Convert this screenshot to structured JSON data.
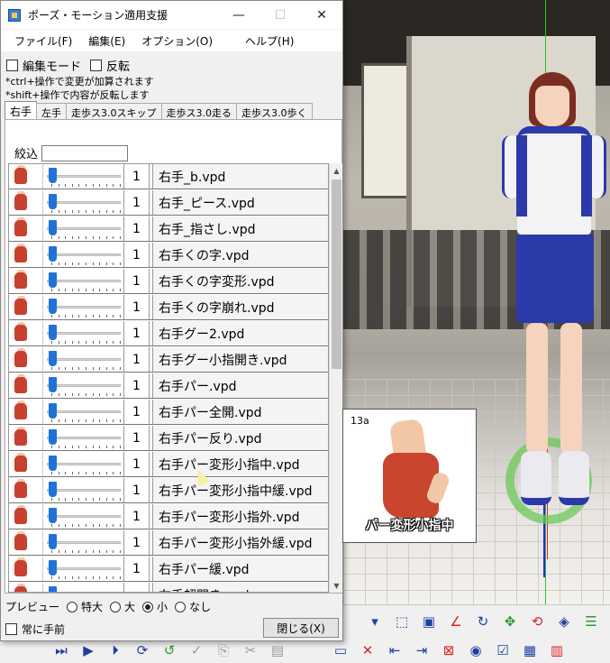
{
  "window": {
    "title": "ポーズ・モーション適用支援",
    "minimize": "—",
    "maximize": "☐",
    "close": "✕"
  },
  "menu": {
    "file": "ファイル(F)",
    "edit": "編集(E)",
    "options": "オプション(O)",
    "help": "ヘルプ(H)"
  },
  "options": {
    "edit_mode": "編集モード",
    "invert": "反転",
    "note1": "*ctrl+操作で変更が加算されます",
    "note2": "*shift+操作で内容が反転します"
  },
  "tabs": [
    {
      "label": "右手",
      "active": true
    },
    {
      "label": "左手",
      "active": false
    },
    {
      "label": "走歩ス3.0スキップ",
      "active": false
    },
    {
      "label": "走歩ス3.0走る",
      "active": false
    },
    {
      "label": "走歩ス3.0歩く",
      "active": false
    }
  ],
  "filter": {
    "label": "絞込",
    "value": ""
  },
  "items": [
    {
      "value": "1",
      "name": "右手_b.vpd"
    },
    {
      "value": "1",
      "name": "右手_ピース.vpd"
    },
    {
      "value": "1",
      "name": "右手_指さし.vpd"
    },
    {
      "value": "1",
      "name": "右手くの字.vpd"
    },
    {
      "value": "1",
      "name": "右手くの字変形.vpd"
    },
    {
      "value": "1",
      "name": "右手くの字崩れ.vpd"
    },
    {
      "value": "1",
      "name": "右手グー2.vpd"
    },
    {
      "value": "1",
      "name": "右手グー小指開き.vpd"
    },
    {
      "value": "1",
      "name": "右手パー.vpd"
    },
    {
      "value": "1",
      "name": "右手パー全開.vpd"
    },
    {
      "value": "1",
      "name": "右手パー反り.vpd"
    },
    {
      "value": "1",
      "name": "右手パー変形小指中.vpd"
    },
    {
      "value": "1",
      "name": "右手パー変形小指中緩.vpd"
    },
    {
      "value": "1",
      "name": "右手パー変形小指外.vpd"
    },
    {
      "value": "1",
      "name": "右手パー変形小指外緩.vpd"
    },
    {
      "value": "1",
      "name": "右手パー緩.vpd"
    },
    {
      "value": "",
      "name": "右手超開き.vpd"
    }
  ],
  "preview": {
    "label": "プレビュー",
    "options": [
      {
        "label": "特大",
        "selected": false
      },
      {
        "label": "大",
        "selected": false
      },
      {
        "label": "小",
        "selected": true
      },
      {
        "label": "なし",
        "selected": false
      }
    ],
    "always_on_top": "常に手前",
    "close_button": "閉じる(X)"
  },
  "popup": {
    "id": "13a",
    "label": "パー変形小指中"
  },
  "colors": {
    "accent": "#1f72d6",
    "hand": "#c8402f",
    "skin": "#f1c7a8"
  }
}
